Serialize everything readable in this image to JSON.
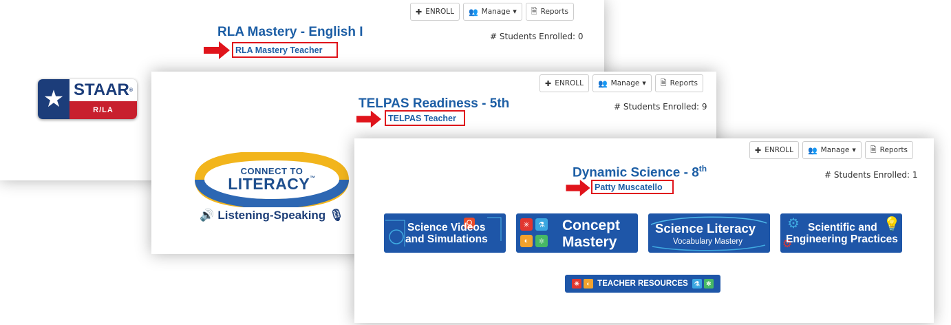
{
  "toolbar": {
    "enroll_label": "ENROLL",
    "manage_label": "Manage",
    "reports_label": "Reports"
  },
  "courses": [
    {
      "title": "RLA Mastery - English I",
      "teacher": "RLA Mastery Teacher",
      "enrolled_text": "# Students Enrolled: 0",
      "logo": {
        "word": "STAAR",
        "sub": "R/LA",
        "reg": "®"
      }
    },
    {
      "title": "TELPAS Readiness - 5th",
      "teacher": "TELPAS Teacher",
      "enrolled_text": "# Students Enrolled: 9",
      "logo": {
        "line1": "CONNECT TO",
        "line2": "LITERACY",
        "tm": "™",
        "sub": "Listening-Speaking"
      }
    },
    {
      "title_main": "Dynamic Science - 8",
      "title_sup": "th",
      "teacher": "Patty Muscatello",
      "enrolled_text": "# Students Enrolled: 1",
      "tiles": [
        {
          "line1": "Science Videos",
          "line2": "and Simulations"
        },
        {
          "line1": "Concept",
          "line2": "Mastery"
        },
        {
          "line1": "Science Literacy",
          "line2": "Vocabulary Mastery"
        },
        {
          "line1": "Scientific and",
          "line2": "Engineering Practices"
        }
      ],
      "teacher_resources": "TEACHER RESOURCES"
    }
  ],
  "colors": {
    "title_blue": "#1c5ea5",
    "highlight_red": "#e0141b",
    "tile_blue": "#1e56a8",
    "staar_blue": "#1c3d7a",
    "staar_red": "#c8202e",
    "ctl_gold": "#f2b51c"
  },
  "icons": {
    "enroll": "plus-icon",
    "manage": "users-icon",
    "reports": "document-icon",
    "pointer": "red-arrow-icon",
    "speaker": "speaker-icon",
    "microphone": "microphone-icon",
    "star": "star-icon"
  }
}
